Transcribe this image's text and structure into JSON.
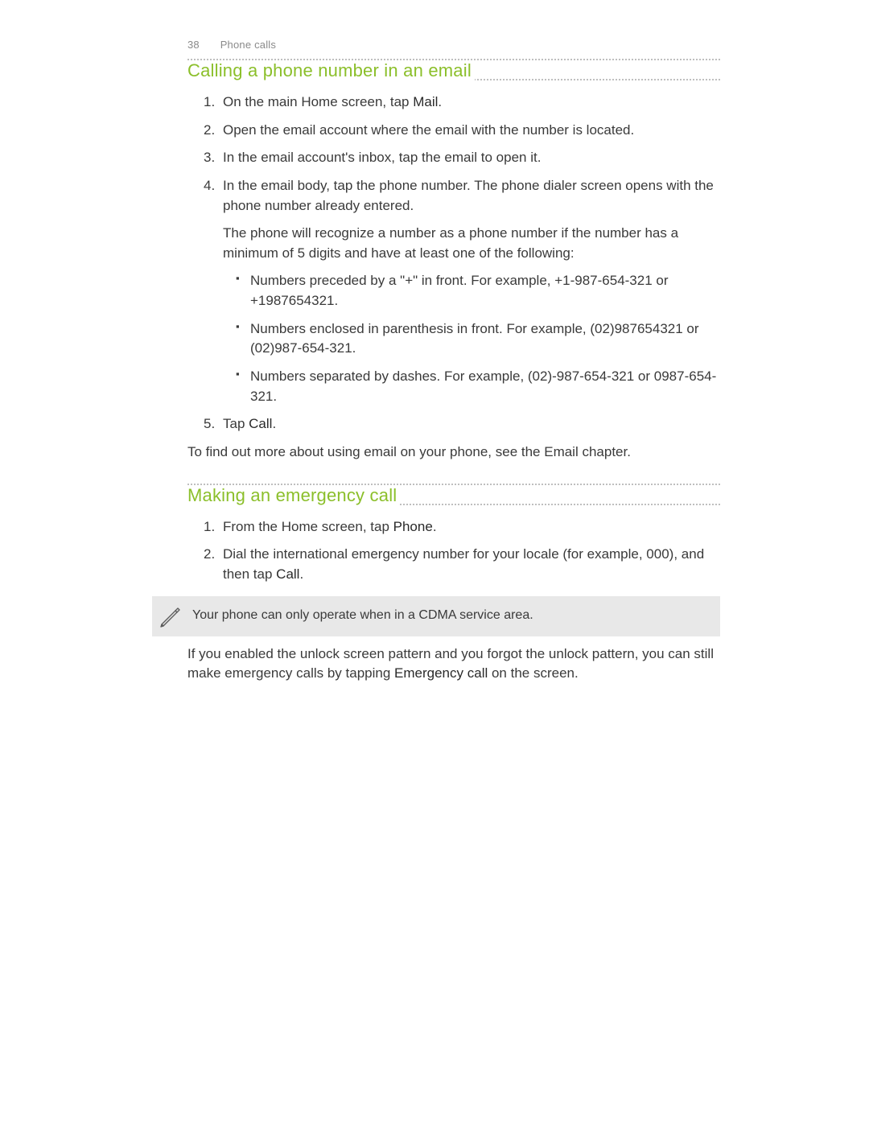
{
  "header": {
    "page_number": "38",
    "chapter": "Phone calls"
  },
  "section1": {
    "title": "Calling a phone number in an email",
    "steps": {
      "s1": {
        "pre": "On the main Home screen, tap ",
        "bold": "Mail",
        "post": "."
      },
      "s2": "Open the email account where the email with the number is located.",
      "s3": "In the email account's inbox, tap the email to open it.",
      "s4": {
        "line1": "In the email body, tap the phone number. The phone dialer screen opens with the phone number already entered.",
        "para": "The phone will recognize a number as a phone number if the number has a minimum of 5 digits and have at least one of the following:",
        "bullets": {
          "b1": "Numbers preceded by a \"+\" in front. For example, +1-987-654-321 or +1987654321.",
          "b2": "Numbers enclosed in parenthesis in front. For example, (02)987654321 or (02)987-654-321.",
          "b3": "Numbers separated by dashes. For example, (02)-987-654-321 or 0987-654-321."
        }
      },
      "s5": {
        "pre": "Tap ",
        "bold": "Call",
        "post": "."
      }
    },
    "footer": "To find out more about using email on your phone, see the Email chapter."
  },
  "section2": {
    "title": "Making an emergency call",
    "steps": {
      "s1": {
        "pre": "From the Home screen, tap ",
        "bold": "Phone",
        "post": "."
      },
      "s2": {
        "pre": "Dial the international emergency number for your locale (for example, 000), and then tap ",
        "bold": "Call",
        "post": "."
      }
    },
    "note": "Your phone can only operate when in a CDMA service area.",
    "footer": {
      "pre": "If you enabled the unlock screen pattern and you forgot the unlock pattern, you can still make emergency calls by tapping ",
      "bold": "Emergency call",
      "post": " on the screen."
    }
  }
}
